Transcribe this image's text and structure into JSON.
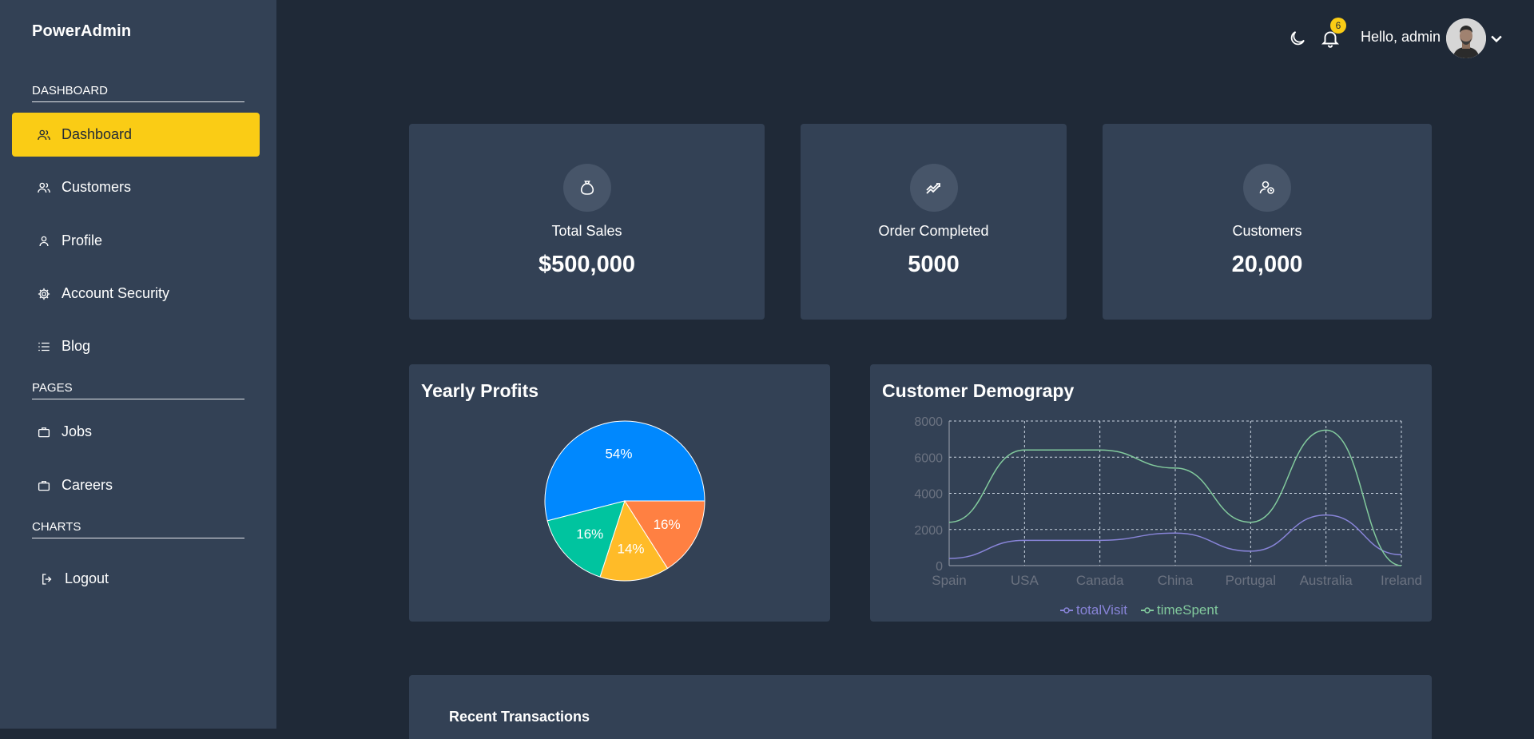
{
  "brand": "PowerAdmin",
  "sidebar": {
    "sections": [
      {
        "label": "DASHBOARD"
      },
      {
        "label": "PAGES"
      },
      {
        "label": "CHARTS"
      }
    ],
    "items": [
      {
        "label": "Dashboard",
        "icon": "users-icon",
        "active": true
      },
      {
        "label": "Customers",
        "icon": "users-icon"
      },
      {
        "label": "Profile",
        "icon": "user-icon"
      },
      {
        "label": "Account Security",
        "icon": "gear-icon"
      },
      {
        "label": "Blog",
        "icon": "list-icon"
      },
      {
        "label": "Jobs",
        "icon": "briefcase-icon"
      },
      {
        "label": "Careers",
        "icon": "briefcase-icon"
      },
      {
        "label": "Logout",
        "icon": "logout-icon"
      }
    ]
  },
  "header": {
    "notification_count": "6",
    "greeting": "Hello, admin",
    "icons": [
      "moon-icon",
      "bell-icon",
      "chevron-down-icon"
    ]
  },
  "stats": [
    {
      "label": "Total Sales",
      "value": "$500,000",
      "icon": "money-bag-icon"
    },
    {
      "label": "Order Completed",
      "value": "5000",
      "icon": "trend-icon"
    },
    {
      "label": "Customers",
      "value": "20,000",
      "icon": "customers-icon"
    }
  ],
  "panels": {
    "profits_title": "Yearly Profits",
    "demography_title": "Customer Demograpy",
    "recent_title": "Recent Transactions"
  },
  "colors": {
    "accent": "#facc15",
    "sidebar": "#334155",
    "background": "#1f2937",
    "pie": [
      "#0088fe",
      "#00c49f",
      "#ffbb28",
      "#ff8042"
    ],
    "totalVisit": "#8884d8",
    "timeSpent": "#82ca9d"
  },
  "chart_data": [
    {
      "type": "pie",
      "title": "Yearly Profits",
      "slices": [
        {
          "label": "54%",
          "value": 54
        },
        {
          "label": "16%",
          "value": 16
        },
        {
          "label": "14%",
          "value": 14
        },
        {
          "label": "16%",
          "value": 16
        }
      ]
    },
    {
      "type": "line",
      "title": "Customer Demograpy",
      "categories": [
        "Spain",
        "USA",
        "Canada",
        "China",
        "Portugal",
        "Australia",
        "Ireland"
      ],
      "ylim": [
        0,
        8000
      ],
      "yticks": [
        "0",
        "2000",
        "4000",
        "6000",
        "8000"
      ],
      "grid": true,
      "legend": "bottom",
      "series": [
        {
          "name": "totalVisit",
          "values": [
            400,
            1400,
            1400,
            1800,
            800,
            2800,
            600
          ]
        },
        {
          "name": "timeSpent",
          "values": [
            2400,
            6400,
            6400,
            5400,
            2400,
            7500,
            0
          ]
        }
      ]
    }
  ]
}
